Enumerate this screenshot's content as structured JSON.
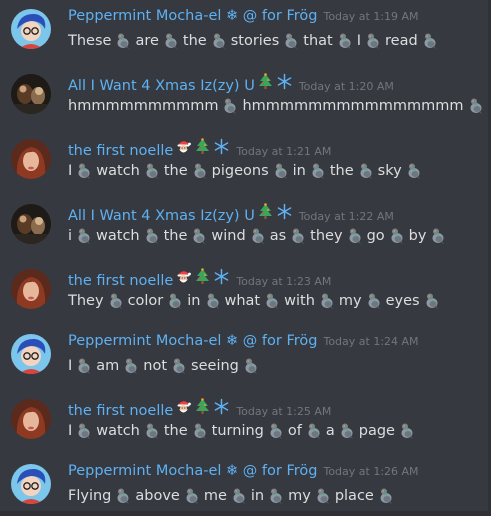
{
  "messages": [
    {
      "user": "Peppermint Mocha-el ❄ @ for Frög",
      "time": "Today at 1:19 AM",
      "avatar": "blue-hair-avatar",
      "words": [
        "These",
        "are",
        "the",
        "stories",
        "that",
        "I",
        "read"
      ]
    },
    {
      "user": "All I Want 4 Xmas Iz(zy) U",
      "time": "Today at 1:20 AM",
      "avatar": "dark-photo-avatar",
      "words": [
        "hmmmmmmmmmm",
        "hmmmmmmmmmmmmmmm"
      ]
    },
    {
      "user": "the first noelle",
      "time": "Today at 1:21 AM",
      "avatar": "red-hair-avatar",
      "words": [
        "I",
        "watch",
        "the",
        "pigeons",
        "in",
        "the",
        "sky"
      ]
    },
    {
      "user": "All I Want 4 Xmas Iz(zy) U",
      "time": "Today at 1:22 AM",
      "avatar": "dark-photo-avatar",
      "words": [
        "i",
        "watch",
        "the",
        "wind",
        "as",
        "they",
        "go",
        "by"
      ]
    },
    {
      "user": "the first noelle",
      "time": "Today at 1:23 AM",
      "avatar": "red-hair-avatar",
      "words": [
        "They",
        "color",
        "in",
        "what",
        "with",
        "my",
        "eyes"
      ]
    },
    {
      "user": "Peppermint Mocha-el ❄ @ for Frög",
      "time": "Today at 1:24 AM",
      "avatar": "blue-hair-avatar",
      "words": [
        "I",
        "am",
        "not",
        "seeing"
      ]
    },
    {
      "user": "the first noelle",
      "time": "Today at 1:25 AM",
      "avatar": "red-hair-avatar",
      "words": [
        "I",
        "watch",
        "the",
        "turning",
        "of",
        "a",
        "page"
      ]
    },
    {
      "user": "Peppermint Mocha-el ❄ @ for Frög",
      "time": "Today at 1:26 AM",
      "avatar": "blue-hair-avatar",
      "words": [
        "Flying",
        "above",
        "me",
        "in",
        "my",
        "place"
      ]
    }
  ],
  "name_emojis": {
    "All I Want 4 Xmas Iz(zy) U": [
      "christmas-tree-icon",
      "snowflake-icon"
    ],
    "the first noelle": [
      "santa-icon",
      "christmas-tree-icon",
      "snowflake-icon"
    ]
  },
  "pigeon_emoji": "pigeon-emoji-icon",
  "colors": {
    "background": "#36393f",
    "username": "#5eb1f3",
    "timestamp": "#72767d",
    "text": "#dcddde"
  }
}
